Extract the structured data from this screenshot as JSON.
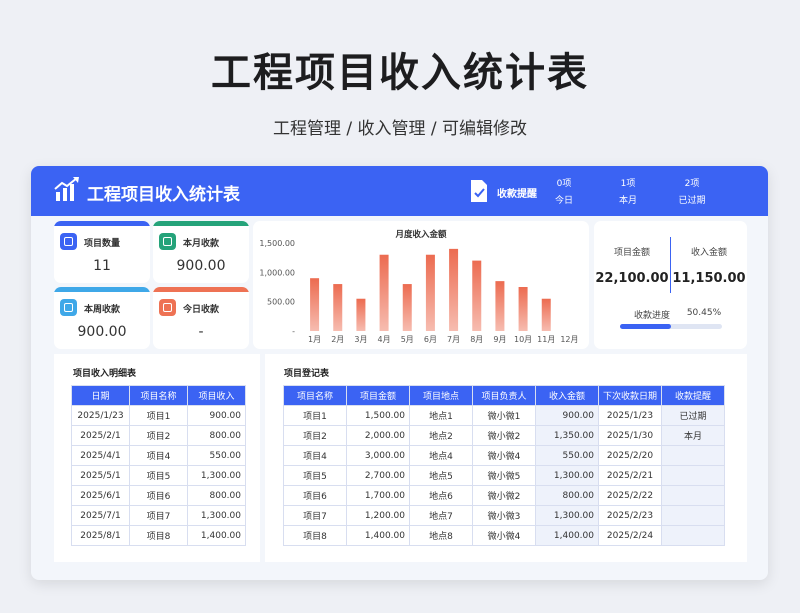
{
  "page": {
    "title": "工程项目收入统计表",
    "subtitle": "工程管理 / 收入管理 / 可编辑修改"
  },
  "header": {
    "title": "工程项目收入统计表",
    "remind_label": "收款提醒",
    "stats": [
      {
        "value": "0项",
        "label": "今日"
      },
      {
        "value": "1项",
        "label": "本月"
      },
      {
        "value": "2项",
        "label": "已过期"
      }
    ]
  },
  "kpis": [
    {
      "label": "项目数量",
      "value": "11",
      "color": "#3b63f3"
    },
    {
      "label": "本月收款",
      "value": "900.00",
      "color": "#25a37a"
    },
    {
      "label": "本周收款",
      "value": "900.00",
      "color": "#3fa8e8"
    },
    {
      "label": "今日收款",
      "value": "-",
      "color": "#ee7254"
    }
  ],
  "summary": {
    "project_amount_label": "项目金额",
    "project_amount": "22,100.00",
    "income_amount_label": "收入金额",
    "income_amount": "11,150.00",
    "progress_label": "收款进度",
    "progress_text": "50.45%",
    "progress_value": 0.5045
  },
  "chart_data": {
    "type": "bar",
    "title": "月度收入金额",
    "categories": [
      "1月",
      "2月",
      "3月",
      "4月",
      "5月",
      "6月",
      "7月",
      "8月",
      "9月",
      "10月",
      "11月",
      "12月"
    ],
    "values": [
      900,
      800,
      550,
      1300,
      800,
      1300,
      1400,
      1200,
      850,
      750,
      550,
      0
    ],
    "ylim": [
      0,
      1500
    ],
    "yticks": [
      "1,500.00",
      "1,000.00",
      "500.00",
      "-"
    ],
    "bar_color": "#ec6b50",
    "grid": false
  },
  "detail_table": {
    "title": "项目收入明细表",
    "columns": [
      "日期",
      "项目名称",
      "项目收入"
    ],
    "rows": [
      [
        "2025/1/23",
        "项目1",
        "900.00"
      ],
      [
        "2025/2/1",
        "项目2",
        "800.00"
      ],
      [
        "2025/4/1",
        "项目4",
        "550.00"
      ],
      [
        "2025/5/1",
        "项目5",
        "1,300.00"
      ],
      [
        "2025/6/1",
        "项目6",
        "800.00"
      ],
      [
        "2025/7/1",
        "项目7",
        "1,300.00"
      ],
      [
        "2025/8/1",
        "项目8",
        "1,400.00"
      ]
    ]
  },
  "register_table": {
    "title": "项目登记表",
    "columns": [
      "项目名称",
      "项目金额",
      "项目地点",
      "项目负责人",
      "收入金额",
      "下次收款日期",
      "收款提醒"
    ],
    "rows": [
      [
        "项目1",
        "1,500.00",
        "地点1",
        "微小微1",
        "900.00",
        "2025/1/23",
        "已过期"
      ],
      [
        "项目2",
        "2,000.00",
        "地点2",
        "微小微2",
        "1,350.00",
        "2025/1/30",
        "本月"
      ],
      [
        "项目4",
        "3,000.00",
        "地点4",
        "微小微4",
        "550.00",
        "2025/2/20",
        ""
      ],
      [
        "项目5",
        "2,700.00",
        "地点5",
        "微小微5",
        "1,300.00",
        "2025/2/21",
        ""
      ],
      [
        "项目6",
        "1,700.00",
        "地点6",
        "微小微2",
        "800.00",
        "2025/2/22",
        ""
      ],
      [
        "项目7",
        "1,200.00",
        "地点7",
        "微小微3",
        "1,300.00",
        "2025/2/23",
        ""
      ],
      [
        "项目8",
        "1,400.00",
        "地点8",
        "微小微4",
        "1,400.00",
        "2025/2/24",
        ""
      ]
    ]
  }
}
